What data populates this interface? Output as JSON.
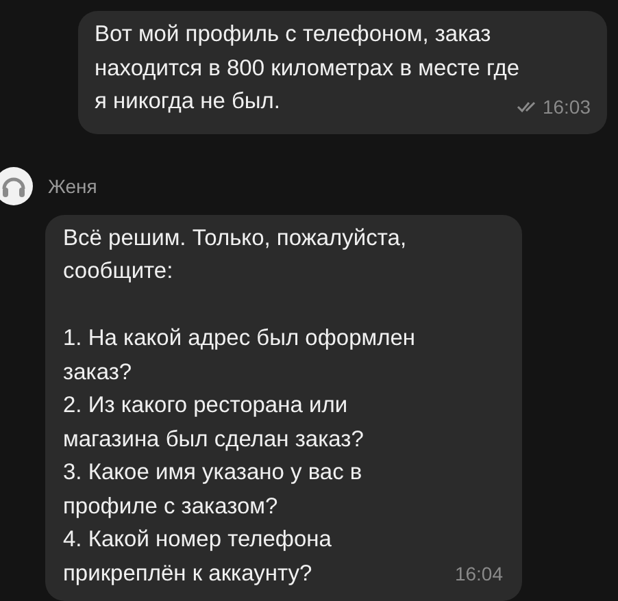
{
  "messages": [
    {
      "kind": "outgoing",
      "text": "Вот мой профиль с телефоном, заказ\nнаходится в 800 километрах в месте где\nя никогда не был.",
      "time": "16:03",
      "read": true
    },
    {
      "kind": "incoming",
      "sender": "Женя",
      "text": "Всё решим. Только, пожалуйста,\nсообщите:\n\n1. На какой адрес был оформлен\nзаказ?\n2. Из какого ресторана или\nмагазина был сделан заказ?\n3. Какое имя указано у вас в\nпрофиле с заказом?\n4. Какой номер телефона\nприкреплён к аккаунту?",
      "time": "16:04"
    }
  ]
}
